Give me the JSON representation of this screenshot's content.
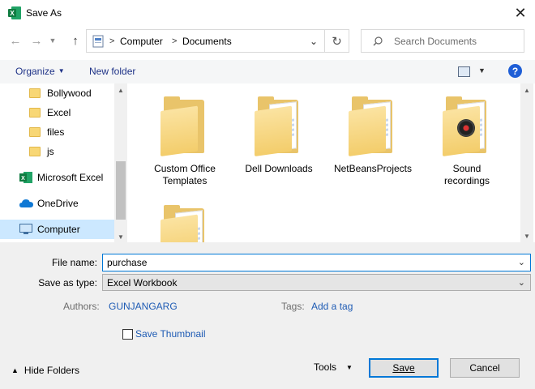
{
  "window": {
    "title": "Save As"
  },
  "nav": {
    "breadcrumb": [
      "Computer",
      "Documents"
    ],
    "search_placeholder": "Search Documents"
  },
  "toolbar": {
    "organize": "Organize",
    "new_folder": "New folder",
    "help": "?"
  },
  "sidebar": {
    "items": [
      {
        "label": "Bollywood",
        "icon": "folder-icon"
      },
      {
        "label": "Excel",
        "icon": "folder-icon"
      },
      {
        "label": "files",
        "icon": "folder-icon"
      },
      {
        "label": "js",
        "icon": "folder-icon"
      },
      {
        "label": "Microsoft Excel",
        "icon": "excel-icon"
      },
      {
        "label": "OneDrive",
        "icon": "cloud-icon"
      },
      {
        "label": "Computer",
        "icon": "computer-icon",
        "selected": true
      }
    ]
  },
  "files": [
    {
      "line1": "Custom Office",
      "line2": "Templates"
    },
    {
      "line1": "Dell Downloads",
      "line2": ""
    },
    {
      "line1": "NetBeansProjects",
      "line2": ""
    },
    {
      "line1": "Sound",
      "line2": "recordings"
    }
  ],
  "form": {
    "file_name_label": "File name:",
    "file_name_value": "purchase",
    "save_type_label": "Save as type:",
    "save_type_value": "Excel Workbook",
    "authors_label": "Authors:",
    "authors_value": "GUNJANGARG",
    "tags_label": "Tags:",
    "tags_value": "Add a tag",
    "thumbnail_label": "Save Thumbnail"
  },
  "footer": {
    "hide_folders": "Hide Folders",
    "tools": "Tools",
    "save": "Save",
    "cancel": "Cancel"
  },
  "colors": {
    "accent": "#0078d7",
    "link": "#1e5bb4",
    "selection": "#cce8ff",
    "folder": "#f8d775"
  }
}
